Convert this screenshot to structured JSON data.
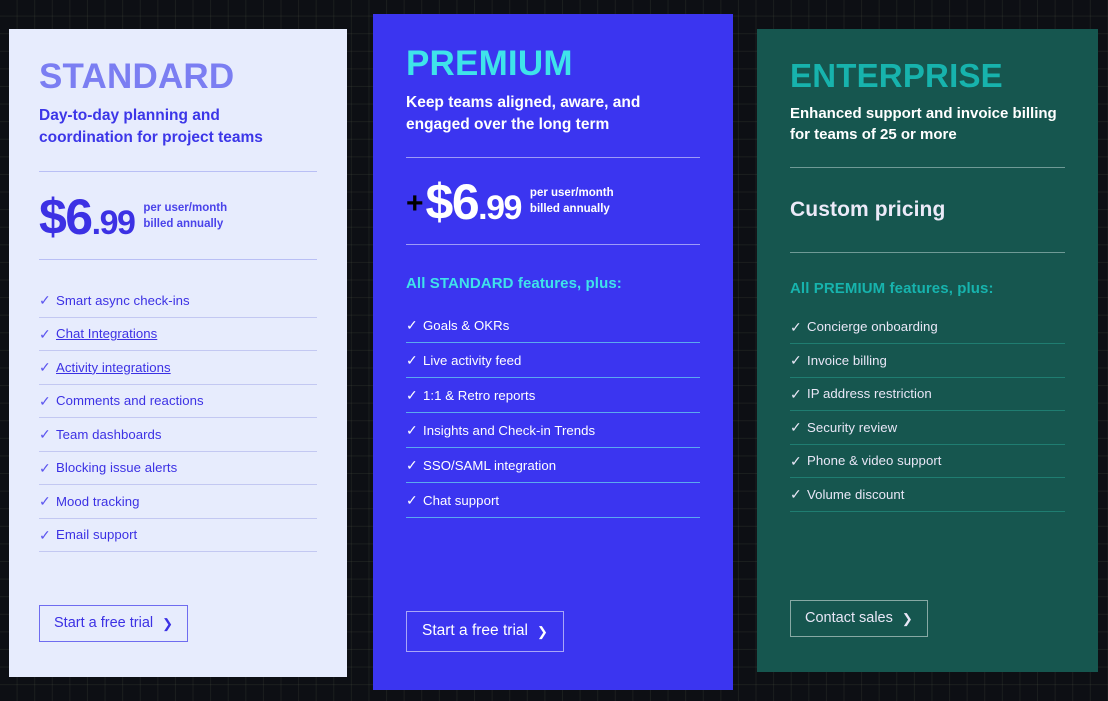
{
  "page": {
    "background_color": "#0d0f14",
    "grid": true
  },
  "plans": [
    {
      "id": "standard",
      "name": "STANDARD",
      "description": "Day-to-day planning and coordination for project teams",
      "price": {
        "prefix": "",
        "dollars": "$6",
        "cents": ".99",
        "note": "per user/month\nbilled annually"
      },
      "custom_pricing": "",
      "section_heading": "",
      "features": [
        {
          "label": "Smart async check-ins",
          "link": false,
          "check": "check-icon"
        },
        {
          "label": "Chat Integrations",
          "link": true,
          "check": "check-icon"
        },
        {
          "label": "Activity integrations",
          "link": true,
          "check": "check-icon"
        },
        {
          "label": "Comments and reactions",
          "link": false,
          "check": "check-icon"
        },
        {
          "label": "Team dashboards",
          "link": false,
          "check": "check-icon"
        },
        {
          "label": "Blocking issue alerts",
          "link": false,
          "check": "check-icon"
        },
        {
          "label": "Mood tracking",
          "link": false,
          "check": "check-icon"
        },
        {
          "label": "Email support",
          "link": false,
          "check": "check-icon"
        }
      ],
      "cta": {
        "label": "Start a free trial",
        "chevron": "chevron-right-icon"
      },
      "colors": {
        "background": "#e7ecfd",
        "title": "#7b7ef2",
        "accent": "#3c31e4"
      }
    },
    {
      "id": "premium",
      "name": "PREMIUM",
      "description": "Keep teams aligned, aware, and engaged over the long term",
      "price": {
        "prefix": "+",
        "dollars": "$6",
        "cents": ".99",
        "note": "per user/month\nbilled annually"
      },
      "custom_pricing": "",
      "section_heading": "All STANDARD features, plus:",
      "features": [
        {
          "label": "Goals & OKRs",
          "link": false,
          "check": "check-icon"
        },
        {
          "label": "Live activity feed",
          "link": false,
          "check": "check-icon"
        },
        {
          "label": "1:1 & Retro reports",
          "link": false,
          "check": "check-icon"
        },
        {
          "label": "Insights and Check-in Trends",
          "link": false,
          "check": "check-icon"
        },
        {
          "label": "SSO/SAML integration",
          "link": false,
          "check": "check-icon"
        },
        {
          "label": "Chat support",
          "link": false,
          "check": "check-icon"
        }
      ],
      "cta": {
        "label": "Start a free trial",
        "chevron": "chevron-right-icon"
      },
      "colors": {
        "background": "#3b35f0",
        "title": "#3fe3ea",
        "accent": "#ffffff"
      }
    },
    {
      "id": "enterprise",
      "name": "ENTERPRISE",
      "description": "Enhanced support and invoice billing for teams of 25 or more",
      "price": null,
      "custom_pricing": "Custom pricing",
      "section_heading": "All PREMIUM features, plus:",
      "features": [
        {
          "label": "Concierge onboarding",
          "link": false,
          "check": "check-icon"
        },
        {
          "label": "Invoice billing",
          "link": false,
          "check": "check-icon"
        },
        {
          "label": "IP address restriction",
          "link": false,
          "check": "check-icon"
        },
        {
          "label": "Security review",
          "link": false,
          "check": "check-icon"
        },
        {
          "label": "Phone & video support",
          "link": false,
          "check": "check-icon"
        },
        {
          "label": "Volume discount",
          "link": false,
          "check": "check-icon"
        }
      ],
      "cta": {
        "label": "Contact sales",
        "chevron": "chevron-right-icon"
      },
      "colors": {
        "background": "#16564f",
        "title": "#17b3ad",
        "accent": "#e8e6f6"
      }
    }
  ],
  "icons": {
    "check": "✓",
    "chevron_right": "❯"
  }
}
